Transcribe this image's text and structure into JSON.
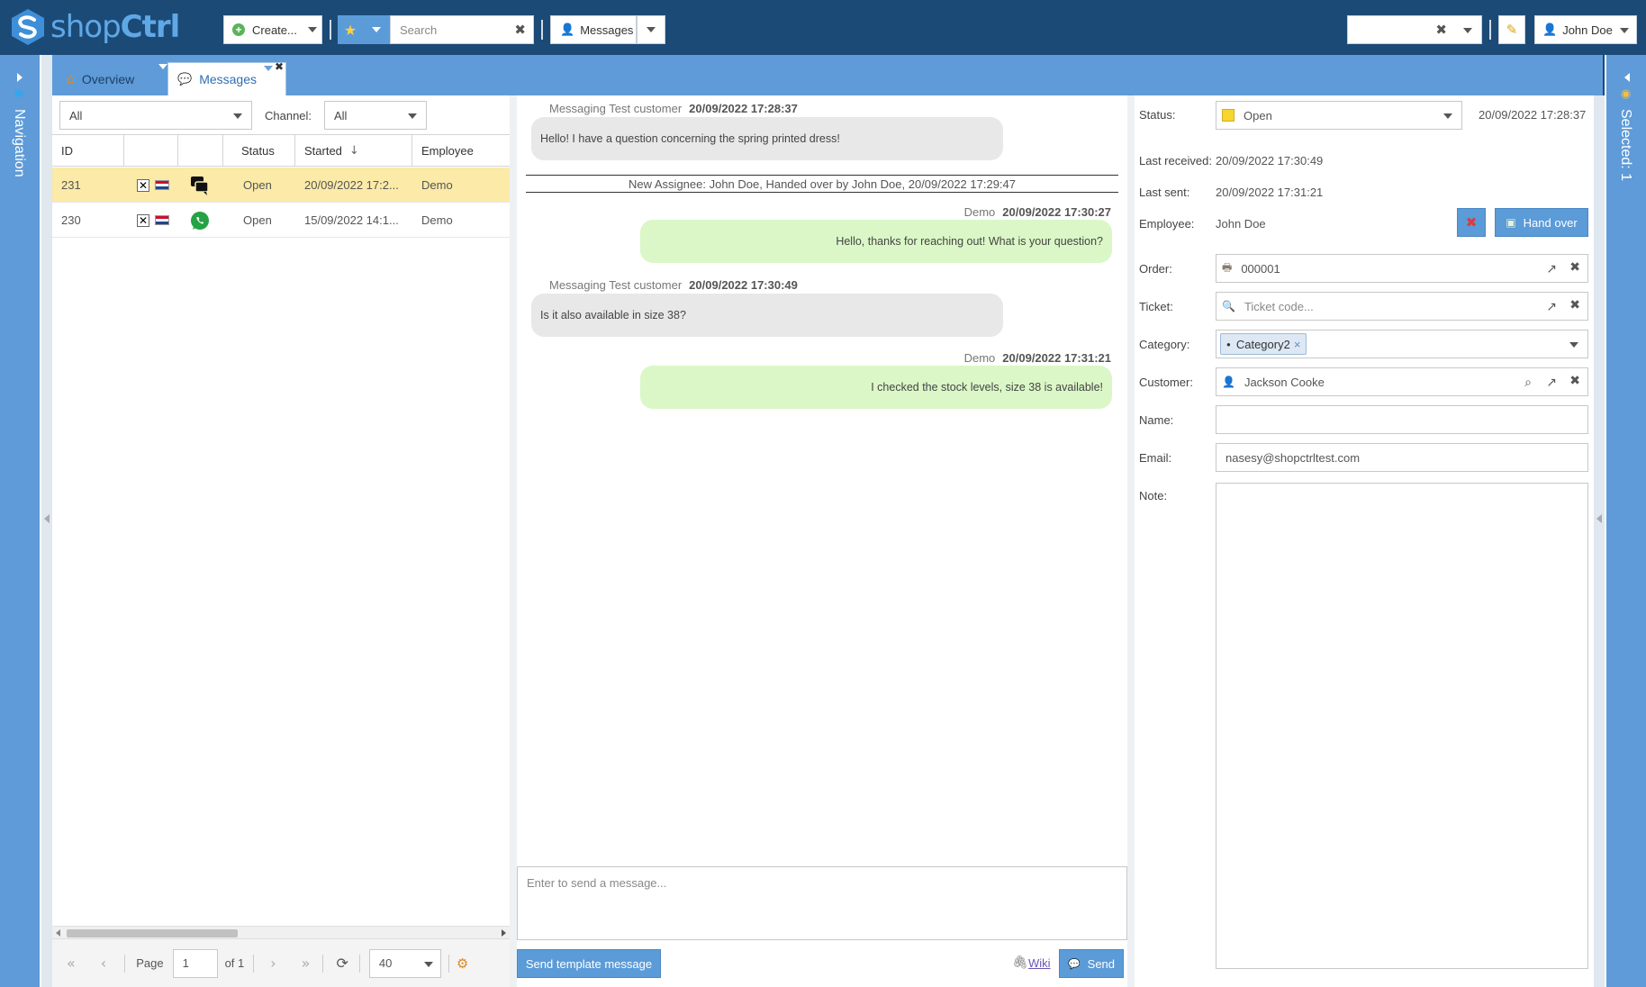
{
  "header": {
    "logo": {
      "part1": "shop",
      "part2": "Ctrl"
    },
    "create_label": "Create...",
    "search_placeholder": "Search",
    "messages_label": "Messages",
    "user_name": "John Doe"
  },
  "tabs": [
    {
      "label": "Overview"
    },
    {
      "label": "Messages"
    }
  ],
  "left_rail": {
    "label": "Navigation"
  },
  "right_rail": {
    "label": "Selected: 1"
  },
  "filters": {
    "status_value": "All",
    "channel_label": "Channel:",
    "channel_value": "All"
  },
  "grid": {
    "columns": [
      "ID",
      "",
      "",
      "Status",
      "Started",
      "Employee"
    ],
    "sort_indicator": "↓",
    "rows": [
      {
        "id": "231",
        "status": "Open",
        "started": "20/09/2022 17:2...",
        "employee": "Demo",
        "channel_icon": "chat-icon",
        "selected": true
      },
      {
        "id": "230",
        "status": "Open",
        "started": "15/09/2022 14:1...",
        "employee": "Demo",
        "channel_icon": "whatsapp-icon",
        "selected": false
      }
    ]
  },
  "pager": {
    "page_label": "Page",
    "page_value": "1",
    "of_label": "of 1",
    "page_size": "40"
  },
  "chat": {
    "messages": [
      {
        "sender": "Messaging Test customer",
        "time": "20/09/2022 17:28:37",
        "text": "Hello! I have a question concerning the spring printed dress!",
        "direction": "in"
      },
      {
        "system": "New Assignee: John Doe, Handed over by John Doe, 20/09/2022 17:29:47"
      },
      {
        "sender": "Demo",
        "time": "20/09/2022 17:30:27",
        "text": "Hello, thanks for reaching out! What is your question?",
        "direction": "out"
      },
      {
        "sender": "Messaging Test customer",
        "time": "20/09/2022 17:30:49",
        "text": "Is it also available in size 38?",
        "direction": "in"
      },
      {
        "sender": "Demo",
        "time": "20/09/2022 17:31:21",
        "text": "I checked the stock levels, size 38 is available!",
        "direction": "out"
      }
    ],
    "composer_placeholder": "Enter to send a message...",
    "template_button": "Send template message",
    "wiki_label": "Wiki",
    "send_label": "Send"
  },
  "details": {
    "status_label": "Status:",
    "status_value": "Open",
    "status_time": "20/09/2022 17:28:37",
    "last_received_label": "Last received:",
    "last_received_value": "20/09/2022 17:30:49",
    "last_sent_label": "Last sent:",
    "last_sent_value": "20/09/2022 17:31:21",
    "employee_label": "Employee:",
    "employee_value": "John Doe",
    "hand_over_label": "Hand over",
    "order_label": "Order:",
    "order_value": "000001",
    "ticket_label": "Ticket:",
    "ticket_placeholder": "Ticket code...",
    "category_label": "Category:",
    "category_tag": "Category2",
    "customer_label": "Customer:",
    "customer_value": "Jackson Cooke",
    "name_label": "Name:",
    "name_value": "",
    "email_label": "Email:",
    "email_value": "nasesy@shopctrltest.com",
    "note_label": "Note:"
  },
  "colors": {
    "header_bg": "#1c4a77",
    "rail_bg": "#5e9bd8",
    "selected_row": "#fbeaa8",
    "incoming_bubble": "#e8e8e8",
    "outgoing_bubble": "#dbf7c7",
    "status_open": "#f7d430",
    "button_blue": "#5b9bd8"
  }
}
